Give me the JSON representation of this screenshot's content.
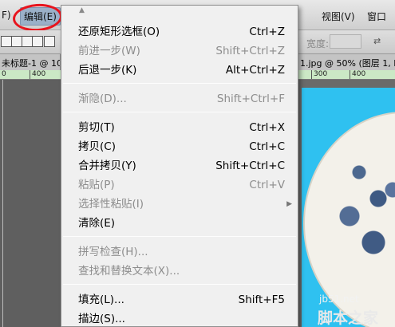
{
  "menubar": {
    "file_fragment": "F)",
    "edit_label": "编辑(E)",
    "view_label": "视图(V)",
    "window_label": "窗口"
  },
  "options_bar": {
    "width_label": "宽度:"
  },
  "documents": {
    "left_tab": "未标题-1 @ 10",
    "right_tab": "1.jpg @ 50% (图层 1, R",
    "left_ruler": [
      "0",
      "400"
    ],
    "right_ruler": [
      "300",
      "400"
    ]
  },
  "edit_menu": {
    "items": [
      {
        "label": "还原矩形选框(O)",
        "shortcut": "Ctrl+Z",
        "enabled": true
      },
      {
        "label": "前进一步(W)",
        "shortcut": "Shift+Ctrl+Z",
        "enabled": false
      },
      {
        "label": "后退一步(K)",
        "shortcut": "Alt+Ctrl+Z",
        "enabled": true
      },
      {
        "label": "渐隐(D)...",
        "shortcut": "Shift+Ctrl+F",
        "enabled": false
      },
      {
        "label": "剪切(T)",
        "shortcut": "Ctrl+X",
        "enabled": true
      },
      {
        "label": "拷贝(C)",
        "shortcut": "Ctrl+C",
        "enabled": true
      },
      {
        "label": "合并拷贝(Y)",
        "shortcut": "Shift+Ctrl+C",
        "enabled": true
      },
      {
        "label": "粘贴(P)",
        "shortcut": "Ctrl+V",
        "enabled": false
      },
      {
        "label": "选择性粘贴(I)",
        "shortcut": "",
        "enabled": false,
        "submenu": true
      },
      {
        "label": "清除(E)",
        "shortcut": "",
        "enabled": true
      },
      {
        "label": "拼写检查(H)...",
        "shortcut": "",
        "enabled": false
      },
      {
        "label": "查找和替换文本(X)...",
        "shortcut": "",
        "enabled": false
      },
      {
        "label": "填充(L)...",
        "shortcut": "Shift+F5",
        "enabled": true
      },
      {
        "label": "描边(S)...",
        "shortcut": "",
        "enabled": true
      }
    ]
  },
  "watermark": {
    "site": "jb51.net",
    "name": "脚本之家"
  },
  "colors": {
    "annotation_circle": "#e8141d",
    "menu_background": "#f0f0f0",
    "disabled_text": "#8d8d8d",
    "image_background": "#2fc1f0"
  }
}
